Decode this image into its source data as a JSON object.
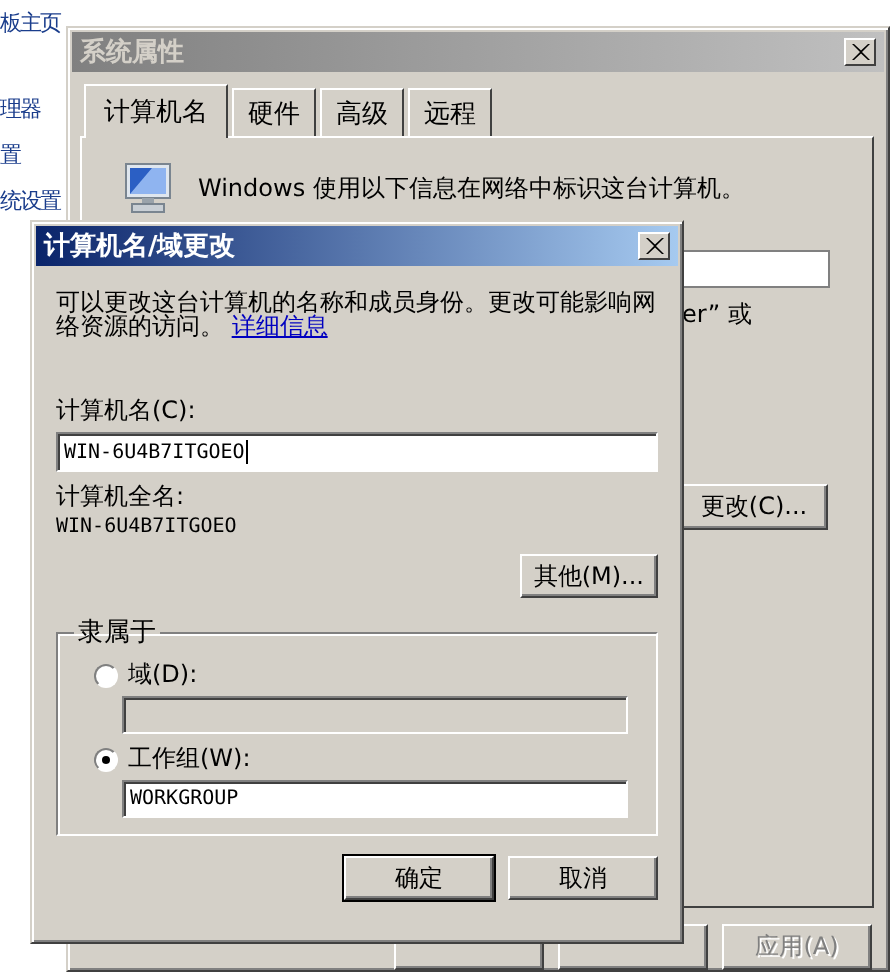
{
  "background_page": {
    "sidebar_links": [
      "板主页",
      "理器",
      "置",
      "统设置"
    ]
  },
  "system_properties": {
    "title": "系统属性",
    "active": false,
    "tabs": [
      {
        "label": "计算机名",
        "selected": true
      },
      {
        "label": "硬件",
        "selected": false
      },
      {
        "label": "高级",
        "selected": false
      },
      {
        "label": "远程",
        "selected": false
      }
    ],
    "intro": "Windows 使用以下信息在网络中标识这台计算机。",
    "fragment": "er” 或",
    "change_button": "更改(C)...",
    "bottom_buttons": [
      {
        "kind": "covered"
      },
      {
        "kind": "covered"
      },
      {
        "kind": "text",
        "label": "应用(A)",
        "disabled": true
      }
    ]
  },
  "dialog": {
    "title": "计算机名/域更改",
    "active": true,
    "description": "可以更改这台计算机的名称和成员身份。更改可能影响网络资源的访问。",
    "link": "详细信息",
    "name_label": "计算机名(C):",
    "name_value": "WIN-6U4B7ITGOEO",
    "full_name_label": "计算机全名:",
    "full_name": "WIN-6U4B7ITGOEO",
    "more_button": "其他(M)...",
    "member_of": {
      "title": "隶属于",
      "options": [
        {
          "label": "域(D):",
          "selected": false
        },
        {
          "label": "工作组(W):",
          "selected": true,
          "value": "WORKGROUP"
        }
      ]
    },
    "buttons": [
      {
        "label": "确定",
        "default": true
      },
      {
        "label": "取消",
        "default": false
      }
    ]
  }
}
